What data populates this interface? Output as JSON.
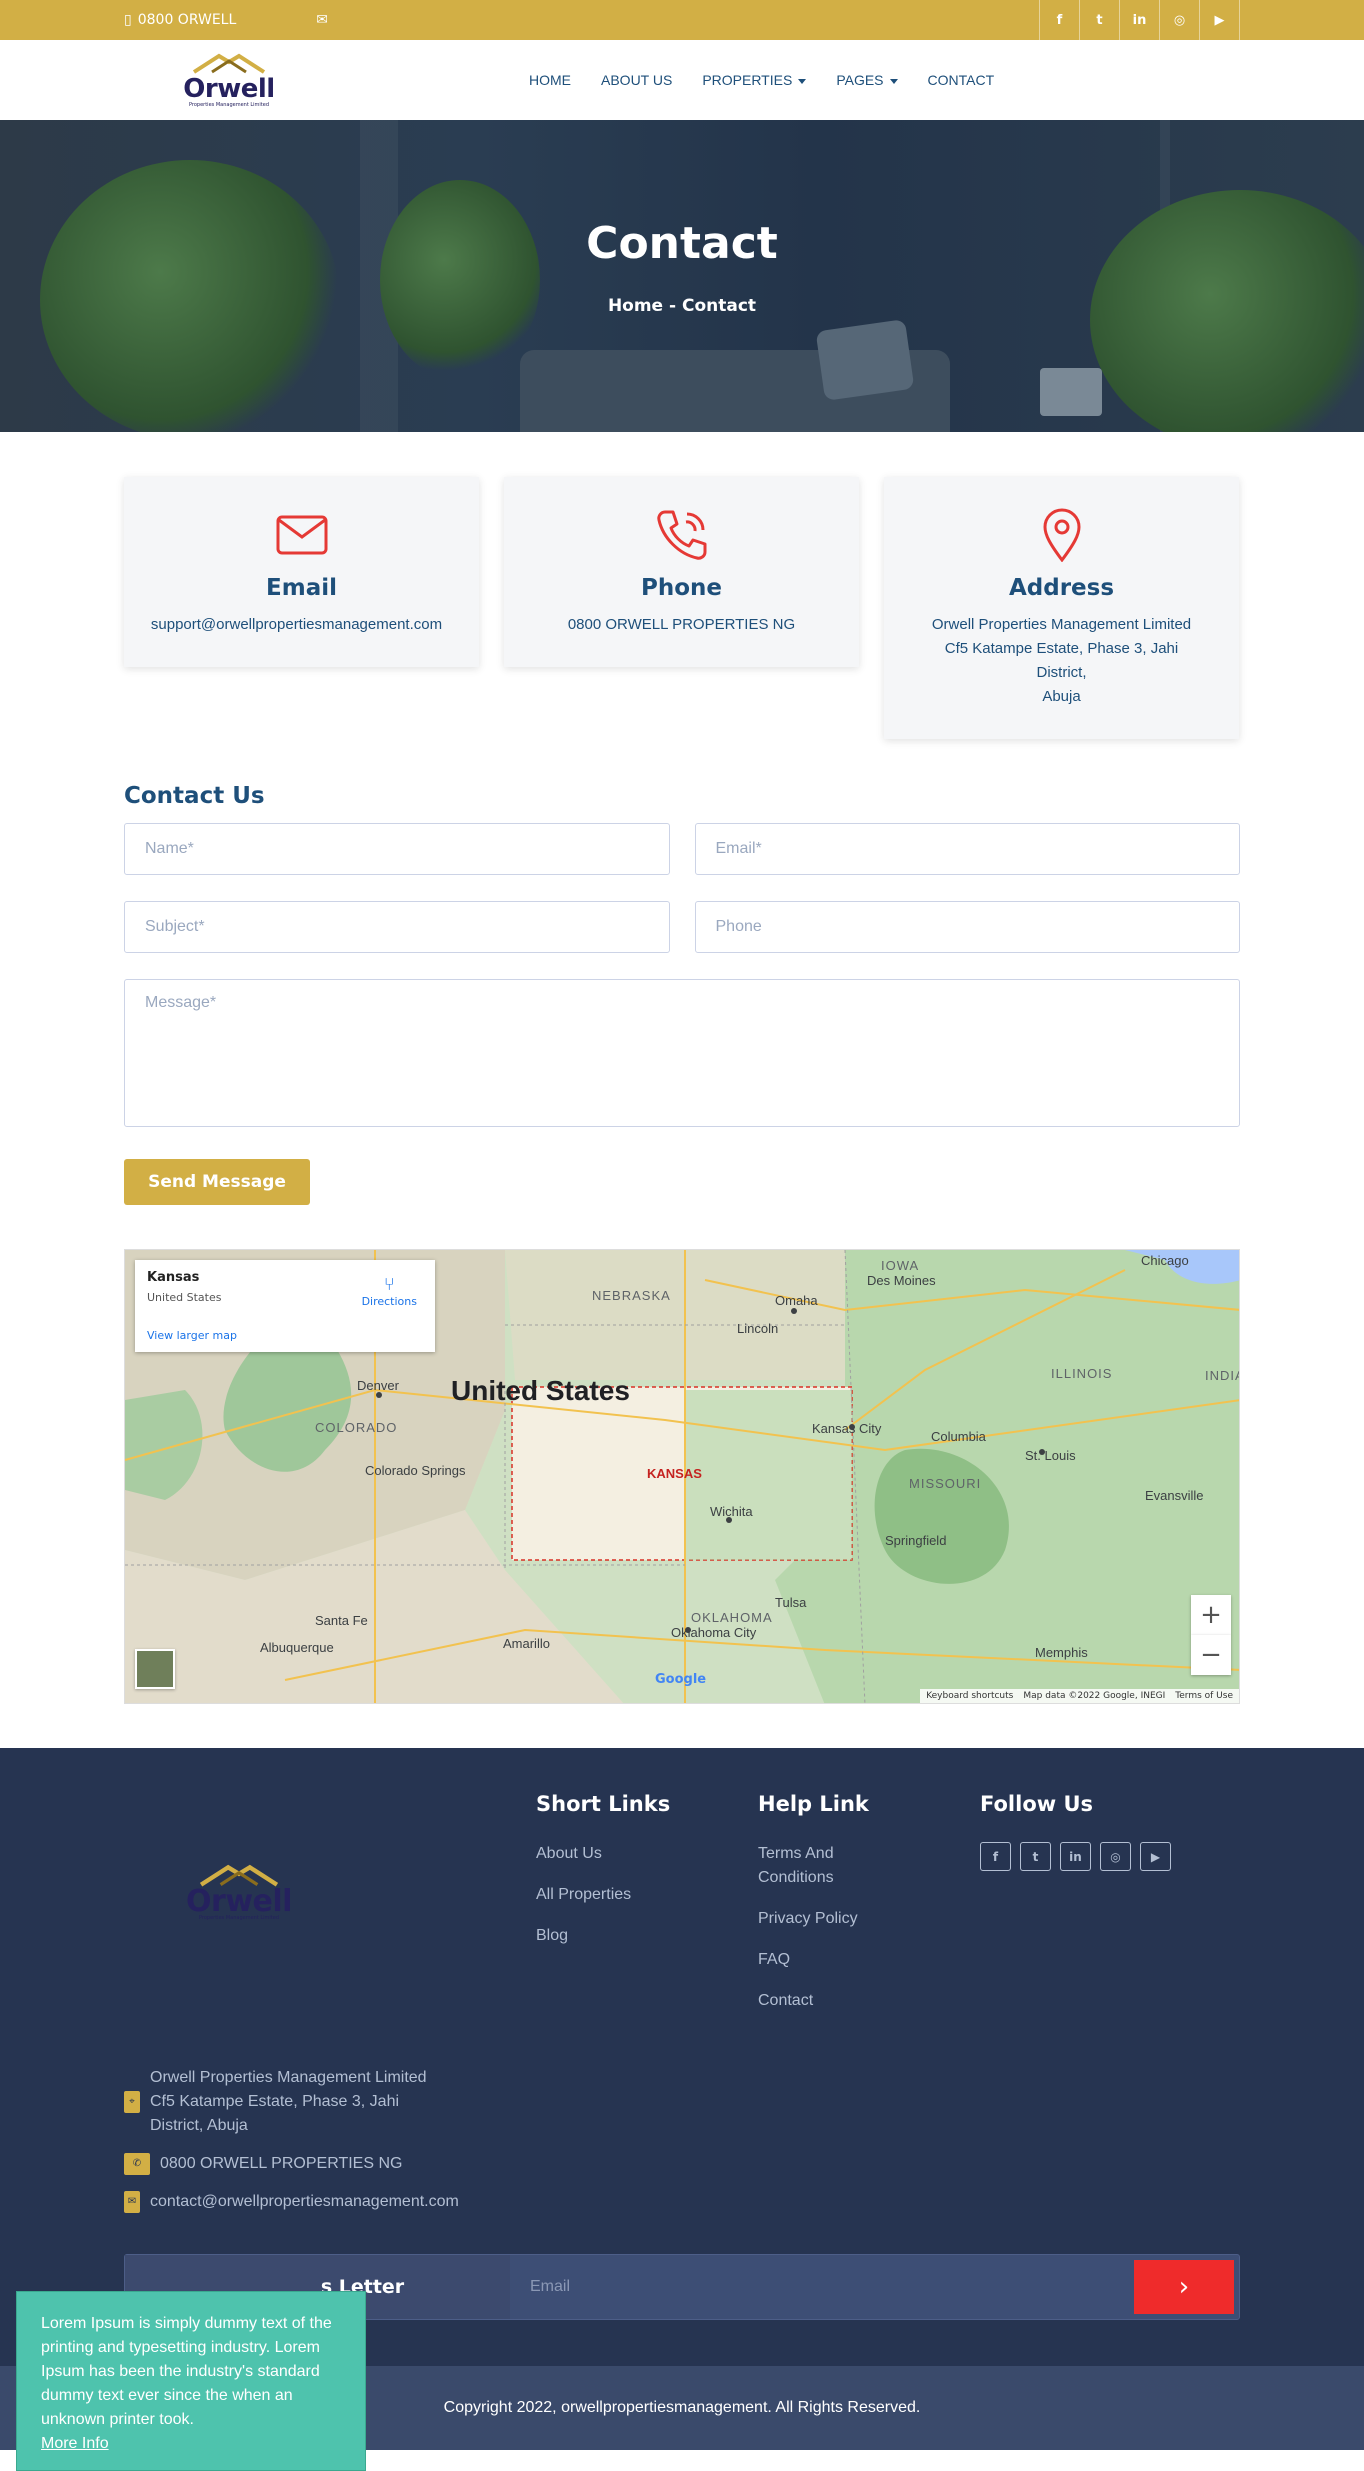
{
  "topbar": {
    "phone": "0800 ORWELL",
    "socials": [
      "facebook-icon",
      "twitter-icon",
      "linkedin-icon",
      "instagram-icon",
      "youtube-icon"
    ]
  },
  "brand": {
    "name": "Orwell",
    "tagline": "Properties Management Limited"
  },
  "nav": {
    "items": [
      "HOME",
      "ABOUT US",
      "PROPERTIES",
      "PAGES",
      "CONTACT"
    ]
  },
  "hero": {
    "title": "Contact",
    "breadcrumb": {
      "home": "Home",
      "sep": "-",
      "current": "Contact"
    }
  },
  "cards": {
    "email": {
      "title": "Email",
      "text": "support@orwellpropertiesmanagement.com"
    },
    "phone": {
      "title": "Phone",
      "text": "0800 ORWELL PROPERTIES NG"
    },
    "address": {
      "title": "Address",
      "line1": "Orwell Properties Management Limited",
      "line2": "Cf5 Katampe Estate, Phase 3, Jahi",
      "line3": "District,",
      "line4": "Abuja"
    }
  },
  "form": {
    "title": "Contact Us",
    "name_placeholder": "Name*",
    "email_placeholder": "Email*",
    "subject_placeholder": "Subject*",
    "phone_placeholder": "Phone",
    "message_placeholder": "Message*",
    "submit": "Send Message"
  },
  "map": {
    "place": "Kansas",
    "country": "United States",
    "directions": "Directions",
    "larger": "View larger map",
    "label_country": "United States",
    "label_state": "KANSAS",
    "cities": [
      "Denver",
      "Kansas City",
      "Wichita",
      "Oklahoma City",
      "St. Louis",
      "Omaha",
      "Lincoln",
      "Des Moines",
      "Chicago",
      "Albuquerque",
      "Santa Fe",
      "Amarillo",
      "Tulsa",
      "Springfield",
      "Memphis",
      "Colorado Springs",
      "Columbia",
      "Evansville"
    ],
    "regions": [
      "NEBRASKA",
      "IOWA",
      "ILLINOIS",
      "COLORADO",
      "MISSOURI",
      "OKLAHOMA",
      "INDIA"
    ],
    "keyboard": "Keyboard shortcuts",
    "mapdata": "Map data ©2022 Google, INEGI",
    "terms": "Terms of Use",
    "google": "Google"
  },
  "footer": {
    "short_links": {
      "title": "Short Links",
      "items": [
        "About Us",
        "All Properties",
        "Blog"
      ]
    },
    "help_links": {
      "title": "Help Link",
      "items": [
        "Terms And Conditions",
        "Privacy Policy",
        "FAQ",
        "Contact"
      ]
    },
    "follow": {
      "title": "Follow Us"
    },
    "address": {
      "line1": "Orwell Properties Management Limited",
      "line2": "Cf5 Katampe Estate, Phase 3, Jahi",
      "line3": "District, Abuja"
    },
    "phone": "0800 ORWELL PROPERTIES NG",
    "email": "contact@orwellpropertiesmanagement.com",
    "newsletter_label": "s Letter",
    "newsletter_placeholder": "Email",
    "copyright": "Copyright 2022, orwellpropertiesmanagement. All Rights Reserved."
  },
  "popup": {
    "text": "Lorem Ipsum is simply dummy text of the printing and typesetting industry. Lorem Ipsum has been the industry's standard dummy text ever since the when an unknown printer took.",
    "link": "More Info"
  },
  "colors": {
    "gold": "#d2af45",
    "navy": "#1e4f7a",
    "footer": "#263451",
    "red": "#e53935",
    "teal": "#4ec3ad"
  }
}
